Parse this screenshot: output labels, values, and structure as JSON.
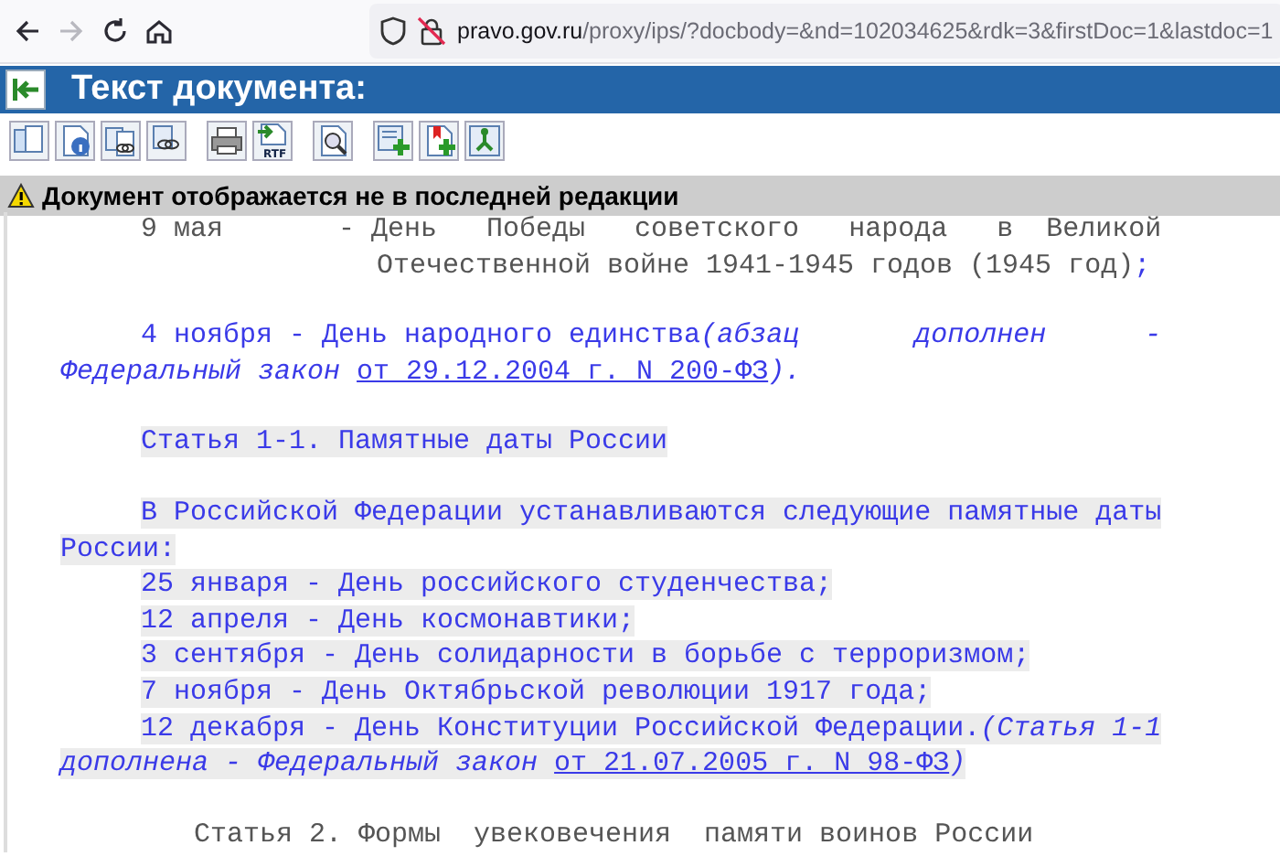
{
  "browser": {
    "nav": [
      {
        "kind": "back",
        "disabled": false
      },
      {
        "kind": "forward",
        "disabled": true
      },
      {
        "kind": "reload",
        "disabled": false
      },
      {
        "kind": "home",
        "disabled": false
      }
    ],
    "url": {
      "host": "pravo.gov.ru",
      "path": "/proxy/ips/?docbody=&nd=102034625&rdk=3&firstDoc=1&lastdoc=1"
    }
  },
  "header": {
    "title": "Текст документа:"
  },
  "toolbar": [
    {
      "kind": "copy"
    },
    {
      "kind": "info"
    },
    {
      "kind": "links"
    },
    {
      "kind": "link"
    },
    {
      "kind": "print"
    },
    {
      "kind": "rtf",
      "label": "RTF"
    },
    {
      "kind": "search"
    },
    {
      "kind": "add"
    },
    {
      "kind": "bookmark"
    },
    {
      "kind": "tree"
    }
  ],
  "warning": {
    "text": "Документ отображается не в последней редакции"
  },
  "document": {
    "paragraphs": [
      {
        "lines": [
          {
            "kind": "first",
            "highlighted": false,
            "segments": [
              {
                "kind": "plain",
                "text": "9 мая       - День   Победы   советского   народа   в  Великой"
              }
            ]
          },
          {
            "kind": "deep",
            "highlighted": false,
            "segments": [
              {
                "kind": "plain",
                "text": "Отечественной войне 1941-1945 годов (1945 год)"
              },
              {
                "kind": "amended",
                "text": ";"
              }
            ]
          }
        ]
      },
      {
        "lines": [
          {
            "kind": "first",
            "highlighted": false,
            "segments": [
              {
                "kind": "amended",
                "text": "4 ноября - День народного единства"
              },
              {
                "kind": "note",
                "text": "(абзац       дополнен      -"
              }
            ]
          },
          {
            "kind": "continuation",
            "highlighted": false,
            "segments": [
              {
                "kind": "note",
                "text": "Федеральный закон "
              },
              {
                "kind": "link",
                "text": "от 29.12.2004 г. N 200-ФЗ"
              },
              {
                "kind": "note",
                "text": ")."
              }
            ]
          }
        ]
      },
      {
        "lines": [
          {
            "kind": "first",
            "highlighted": true,
            "segments": [
              {
                "kind": "amended",
                "text": "Статья 1-1. Памятные даты России"
              }
            ]
          }
        ]
      },
      {
        "lines": [
          {
            "kind": "first",
            "highlighted": true,
            "segments": [
              {
                "kind": "amended",
                "text": "В Российской Федерации устанавливаются следующие памятные даты"
              }
            ]
          },
          {
            "kind": "continuation",
            "highlighted": true,
            "segments": [
              {
                "kind": "amended",
                "text": "России:"
              }
            ]
          },
          {
            "kind": "first",
            "highlighted": true,
            "segments": [
              {
                "kind": "amended",
                "text": "25 января - День российского студенчества;"
              }
            ]
          },
          {
            "kind": "first",
            "highlighted": true,
            "segments": [
              {
                "kind": "amended",
                "text": "12 апреля - День космонавтики;"
              }
            ]
          },
          {
            "kind": "first",
            "highlighted": true,
            "segments": [
              {
                "kind": "amended",
                "text": "3 сентября - День солидарности в борьбе с терроризмом;"
              }
            ]
          },
          {
            "kind": "first",
            "highlighted": true,
            "segments": [
              {
                "kind": "amended",
                "text": "7 ноября - День Октябрьской революции 1917 года;"
              }
            ]
          },
          {
            "kind": "first",
            "highlighted": true,
            "segments": [
              {
                "kind": "amended",
                "text": "12 декабря - День Конституции Российской Федерации."
              },
              {
                "kind": "note",
                "text": "(Статья 1-1"
              }
            ]
          },
          {
            "kind": "continuation",
            "highlighted": true,
            "segments": [
              {
                "kind": "note",
                "text": "дополнена - Федеральный закон "
              },
              {
                "kind": "link",
                "text": "от 21.07.2005 г. N 98-ФЗ"
              },
              {
                "kind": "note",
                "text": ")"
              }
            ]
          }
        ]
      },
      {
        "lines": [
          {
            "kind": "heading",
            "highlighted": false,
            "segments": [
              {
                "kind": "plain",
                "text": "Статья 2. Формы  увековечения  памяти воинов России"
              }
            ]
          }
        ]
      }
    ]
  }
}
